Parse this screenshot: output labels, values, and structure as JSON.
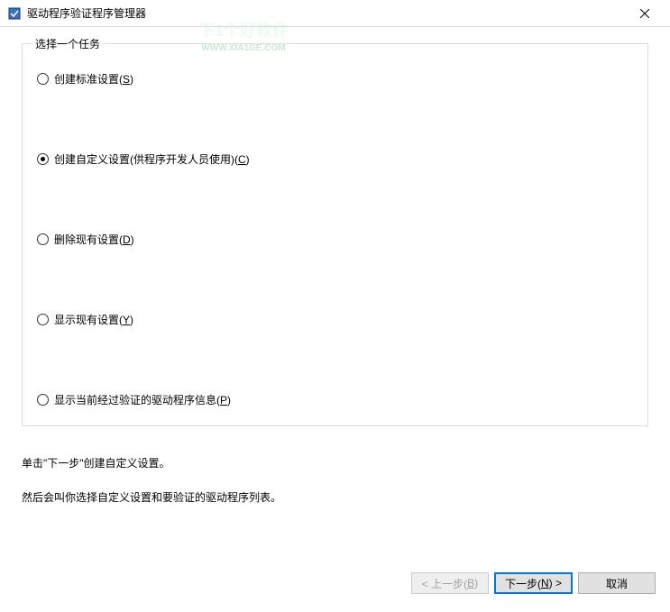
{
  "window": {
    "title": "驱动程序验证程序管理器"
  },
  "groupbox": {
    "legend": "选择一个任务",
    "options": [
      {
        "label": "创建标准设置(",
        "accel": "S",
        "suffix": ")",
        "selected": false
      },
      {
        "label": "创建自定义设置(供程序开发人员使用)(",
        "accel": "C",
        "suffix": ")",
        "selected": true
      },
      {
        "label": "删除现有设置(",
        "accel": "D",
        "suffix": ")",
        "selected": false
      },
      {
        "label": "显示现有设置(",
        "accel": "Y",
        "suffix": ")",
        "selected": false
      },
      {
        "label": "显示当前经过验证的驱动程序信息(",
        "accel": "P",
        "suffix": ")",
        "selected": false
      }
    ]
  },
  "description": {
    "line1": "单击\"下一步\"创建自定义设置。",
    "line2": "然后会叫你选择自定义设置和要验证的驱动程序列表。"
  },
  "buttons": {
    "back_pre": "< 上一步(",
    "back_accel": "B",
    "back_suf": ")",
    "next_pre": "下一步(",
    "next_accel": "N",
    "next_suf": ") >",
    "cancel": "取消"
  },
  "watermark": {
    "main": "下1个好软件",
    "sub": "WWW.XIA1GE.COM"
  }
}
